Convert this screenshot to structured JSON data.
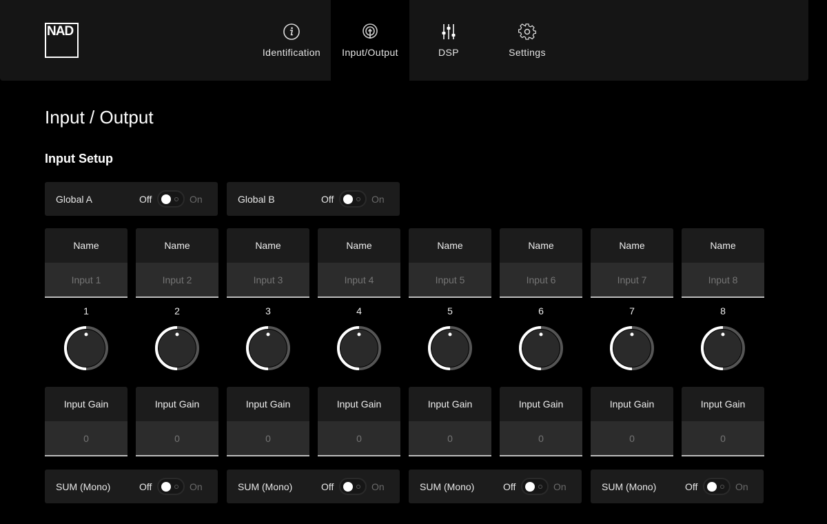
{
  "header": {
    "logo_text": "NAD",
    "nav": [
      {
        "label": "Identification",
        "icon": "info-icon",
        "active": false
      },
      {
        "label": "Input/Output",
        "icon": "broadcast-icon",
        "active": true
      },
      {
        "label": "DSP",
        "icon": "sliders-icon",
        "active": false
      },
      {
        "label": "Settings",
        "icon": "gear-icon",
        "active": false
      }
    ]
  },
  "page": {
    "title": "Input / Output",
    "section_title": "Input Setup"
  },
  "globals": [
    {
      "label": "Global A",
      "off_label": "Off",
      "on_label": "On",
      "state": "off"
    },
    {
      "label": "Global B",
      "off_label": "Off",
      "on_label": "On",
      "state": "off"
    }
  ],
  "channels": [
    {
      "number": "1",
      "name_label": "Name",
      "name_placeholder": "Input 1",
      "gain_label": "Input Gain",
      "gain_value": "0",
      "knob_level": 0.5
    },
    {
      "number": "2",
      "name_label": "Name",
      "name_placeholder": "Input 2",
      "gain_label": "Input Gain",
      "gain_value": "0",
      "knob_level": 0.5
    },
    {
      "number": "3",
      "name_label": "Name",
      "name_placeholder": "Input 3",
      "gain_label": "Input Gain",
      "gain_value": "0",
      "knob_level": 0.5
    },
    {
      "number": "4",
      "name_label": "Name",
      "name_placeholder": "Input 4",
      "gain_label": "Input Gain",
      "gain_value": "0",
      "knob_level": 0.5
    },
    {
      "number": "5",
      "name_label": "Name",
      "name_placeholder": "Input 5",
      "gain_label": "Input Gain",
      "gain_value": "0",
      "knob_level": 0.5
    },
    {
      "number": "6",
      "name_label": "Name",
      "name_placeholder": "Input 6",
      "gain_label": "Input Gain",
      "gain_value": "0",
      "knob_level": 0.5
    },
    {
      "number": "7",
      "name_label": "Name",
      "name_placeholder": "Input 7",
      "gain_label": "Input Gain",
      "gain_value": "0",
      "knob_level": 0.5
    },
    {
      "number": "8",
      "name_label": "Name",
      "name_placeholder": "Input 8",
      "gain_label": "Input Gain",
      "gain_value": "0",
      "knob_level": 0.5
    }
  ],
  "sum_mono": [
    {
      "label": "SUM (Mono)",
      "off_label": "Off",
      "on_label": "On",
      "state": "off"
    },
    {
      "label": "SUM (Mono)",
      "off_label": "Off",
      "on_label": "On",
      "state": "off"
    },
    {
      "label": "SUM (Mono)",
      "off_label": "Off",
      "on_label": "On",
      "state": "off"
    },
    {
      "label": "SUM (Mono)",
      "off_label": "Off",
      "on_label": "On",
      "state": "off"
    }
  ],
  "colors": {
    "background": "#000000",
    "panel": "#1c1c1c",
    "input_bg": "#2c2c2c",
    "knob_active": "#ffffff",
    "knob_inactive": "#555555"
  }
}
